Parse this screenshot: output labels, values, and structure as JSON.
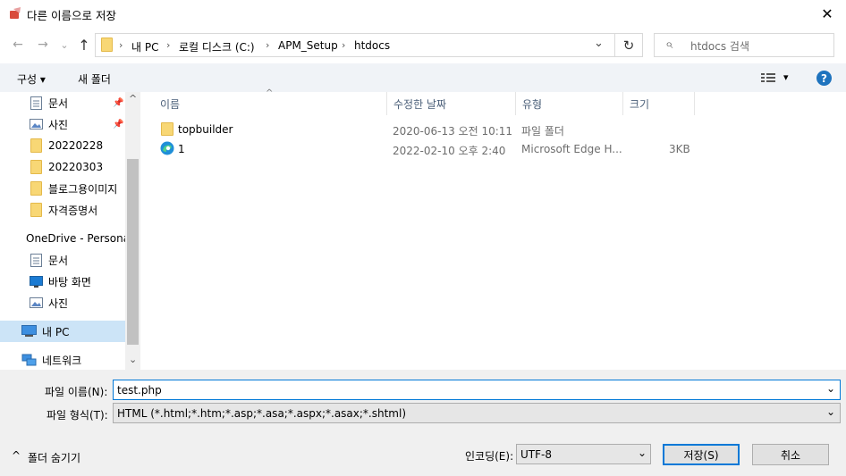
{
  "window": {
    "title": "다른 이름으로 저장",
    "close_glyph": "✕"
  },
  "nav": {
    "back": "←",
    "forward": "→",
    "recent": "⌄",
    "up": "↑"
  },
  "address": {
    "crumbs": [
      "내 PC",
      "로컬 디스크 (C:)",
      "APM_Setup",
      "htdocs"
    ],
    "sep": "›",
    "dropdown": "⌄",
    "refresh": "↻"
  },
  "search": {
    "placeholder": "htdocs 검색",
    "icon": "⌕"
  },
  "toolbar": {
    "organize": "구성 ▾",
    "new_folder": "새 폴더",
    "view": "▾",
    "help": "?"
  },
  "sidebar": [
    {
      "label": "문서",
      "icon": "document-icon",
      "pinned": true
    },
    {
      "label": "사진",
      "icon": "picture-icon",
      "pinned": true
    },
    {
      "label": "20220228",
      "icon": "folder-icon"
    },
    {
      "label": "20220303",
      "icon": "folder-icon"
    },
    {
      "label": "블로그용이미지",
      "icon": "folder-icon"
    },
    {
      "label": "자격증명서",
      "icon": "folder-icon"
    },
    {
      "label": "OneDrive - Persona",
      "icon": "cloud-icon"
    },
    {
      "label": "문서",
      "icon": "document-icon"
    },
    {
      "label": "바탕 화면",
      "icon": "desktop-icon"
    },
    {
      "label": "사진",
      "icon": "picture-icon"
    },
    {
      "label": "내 PC",
      "icon": "pc-icon",
      "selected": true
    },
    {
      "label": "네트워크",
      "icon": "network-icon"
    }
  ],
  "columns": {
    "name": "이름",
    "date": "수정한 날짜",
    "type": "유형",
    "size": "크기",
    "sort_glyph": "^"
  },
  "files": [
    {
      "name": "topbuilder",
      "date": "2020-06-13 오전 10:11",
      "type": "파일 폴더",
      "size": "",
      "icon": "folder-icon"
    },
    {
      "name": "1",
      "date": "2022-02-10 오후 2:40",
      "type": "Microsoft Edge H...",
      "size": "3KB",
      "icon": "edge-icon"
    }
  ],
  "form": {
    "filename_label": "파일 이름(N):",
    "filename_value": "test.php",
    "filetype_label": "파일 형식(T):",
    "filetype_value": "HTML (*.html;*.htm;*.asp;*.asa;*.aspx;*.asax;*.shtml)",
    "encoding_label": "인코딩(E):",
    "encoding_value": "UTF-8",
    "save_label": "저장(S)",
    "cancel_label": "취소",
    "hide_folders": "폴더 숨기기",
    "dropdown_glyph": "⌄"
  },
  "scroll": {
    "up": "^",
    "down": "⌄"
  },
  "colors": {
    "accent": "#0078d7",
    "selected": "#cce4f7",
    "help": "#1e73be"
  }
}
